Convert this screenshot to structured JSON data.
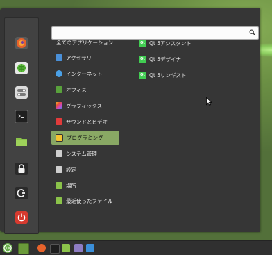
{
  "search": {
    "value": "",
    "placeholder": ""
  },
  "favorites": [
    {
      "name": "firefox-icon",
      "color": "#e8632b"
    },
    {
      "name": "globe-icon",
      "color": "#5fbe3c"
    },
    {
      "name": "settings-toggle-icon",
      "color": "#d4d4d4"
    },
    {
      "name": "terminal-icon",
      "color": "#2b2b2b"
    },
    {
      "name": "folder-icon",
      "color": "#8bc34a"
    },
    {
      "name": "lock-icon",
      "color": "#f2f2f2"
    },
    {
      "name": "logout-icon",
      "color": "#f2f2f2"
    },
    {
      "name": "power-icon",
      "color": "#d63a2f"
    }
  ],
  "categories": [
    {
      "label": "全てのアプリケーション",
      "icon": "none",
      "color": ""
    },
    {
      "label": "アクセサリ",
      "icon": "accessories-icon",
      "color": "#4a90d9"
    },
    {
      "label": "インターネット",
      "icon": "internet-cloud-icon",
      "color": "#4aa0e6"
    },
    {
      "label": "オフィス",
      "icon": "office-icon",
      "color": "#59a13c"
    },
    {
      "label": "グラフィックス",
      "icon": "graphics-icon",
      "color": "#c64ad1"
    },
    {
      "label": "サウンドとビデオ",
      "icon": "multimedia-icon",
      "color": "#e23b3b"
    },
    {
      "label": "プログラミング",
      "icon": "programming-icon",
      "color": "#f5c431",
      "selected": true
    },
    {
      "label": "システム管理",
      "icon": "system-admin-icon",
      "color": "#cfcfcf"
    },
    {
      "label": "設定",
      "icon": "preferences-icon",
      "color": "#cfcfcf"
    },
    {
      "label": "場所",
      "icon": "places-folder-icon",
      "color": "#8bc34a"
    },
    {
      "label": "最近使ったファイル",
      "icon": "recent-files-icon",
      "color": "#8bc34a"
    }
  ],
  "apps": [
    {
      "label": "Qt 5アシスタント",
      "icon": "qt-icon"
    },
    {
      "label": "Qt 5デザイナ",
      "icon": "qt-icon"
    },
    {
      "label": "Qt 5リンギスト",
      "icon": "qt-icon"
    }
  ],
  "qt_icon_text": "Qt",
  "panel": {
    "items": [
      {
        "name": "mint-menu-icon",
        "color": "#6ab04c"
      },
      {
        "name": "show-desktop-icon",
        "color": "#6a9a3a"
      },
      {
        "name": "firefox-launcher-icon",
        "color": "#e8632b"
      },
      {
        "name": "terminal-launcher-icon",
        "color": "#1e1e1e"
      },
      {
        "name": "files-launcher-icon",
        "color": "#8bc34a"
      },
      {
        "name": "text-editor-launcher-icon",
        "color": "#8e7cc3"
      },
      {
        "name": "software-launcher-icon",
        "color": "#3b8fd9"
      }
    ]
  }
}
